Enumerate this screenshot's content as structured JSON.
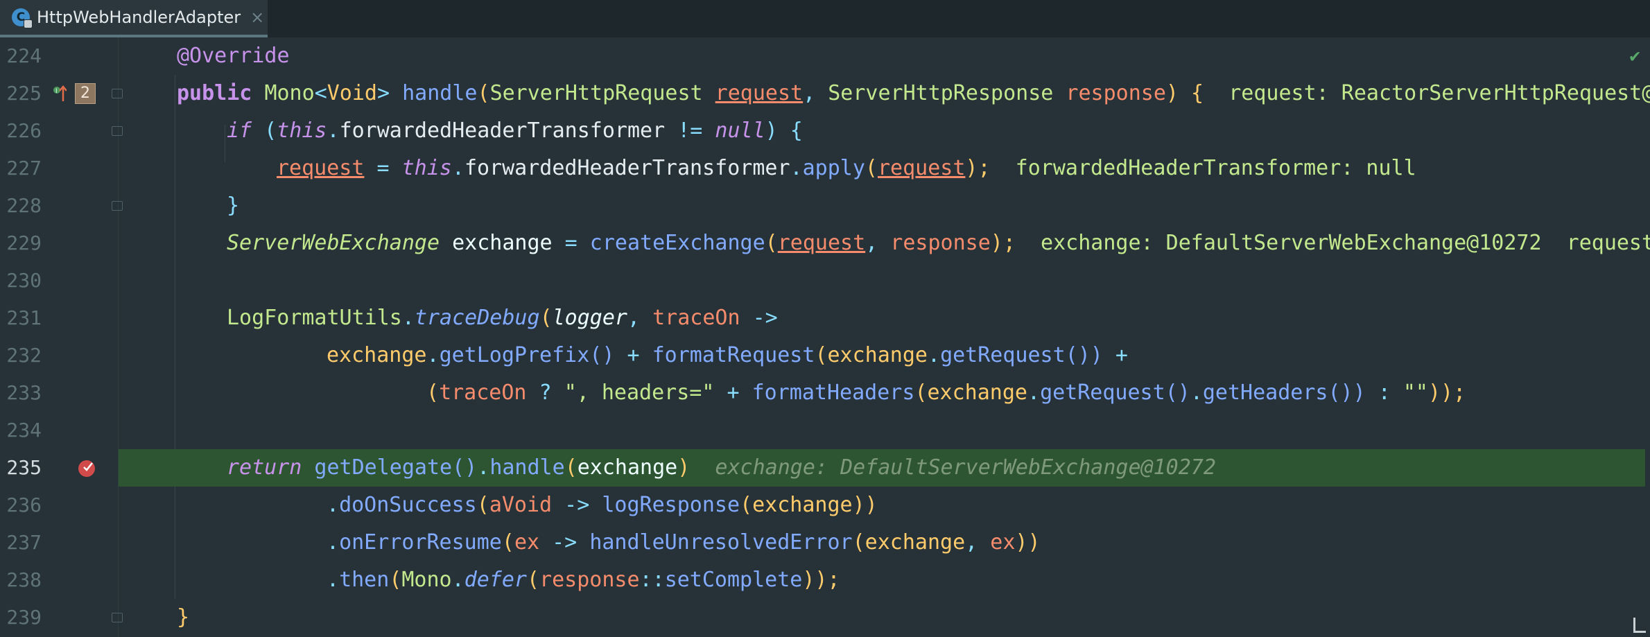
{
  "tab": {
    "title": "HttpWebHandlerAdapter",
    "icon": "class-icon",
    "close_icon": "×"
  },
  "status": {
    "analysis_icon": "✔"
  },
  "lines": [
    {
      "num": "224"
    },
    {
      "num": "225",
      "badge": "2"
    },
    {
      "num": "226"
    },
    {
      "num": "227"
    },
    {
      "num": "228"
    },
    {
      "num": "229"
    },
    {
      "num": "230"
    },
    {
      "num": "231"
    },
    {
      "num": "232"
    },
    {
      "num": "233"
    },
    {
      "num": "234"
    },
    {
      "num": "235"
    },
    {
      "num": "236"
    },
    {
      "num": "237"
    },
    {
      "num": "238"
    },
    {
      "num": "239"
    }
  ],
  "code": {
    "l224": {
      "annotation": "@Override"
    },
    "l225": {
      "public": "public",
      "mono": "Mono",
      "lt": "<",
      "void": "Void",
      "gt": ">",
      "method": "handle",
      "paren_open": "(",
      "type1": "ServerHttpRequest",
      "p1": "request",
      "comma": ", ",
      "type2": "ServerHttpResponse",
      "p2": "response",
      "paren_close": ")",
      "brace": " {",
      "hint": "  request: ReactorServerHttpRequest@"
    },
    "l226": {
      "if": "if",
      "open": " (",
      "this": "this",
      "dot": ".",
      "field": "forwardedHeaderTransformer",
      "neq": " != ",
      "null": "null",
      "close": ")",
      "brace": " {"
    },
    "l227": {
      "var": "request",
      "eq": " = ",
      "this": "this",
      "dot": ".",
      "field": "forwardedHeaderTransformer",
      "dot2": ".",
      "apply": "apply",
      "open": "(",
      "arg": "request",
      "close": ");",
      "hint": "  forwardedHeaderTransformer: null"
    },
    "l228": {
      "brace": "}"
    },
    "l229": {
      "type": "ServerWebExchange",
      "var": " exchange",
      "eq": " = ",
      "fn": "createExchange",
      "open": "(",
      "a1": "request",
      "comma": ", ",
      "a2": "response",
      "close": ");",
      "hint": "  exchange: DefaultServerWebExchange@10272  request"
    },
    "l231": {
      "cls": "LogFormatUtils",
      "dot": ".",
      "fn": "traceDebug",
      "open": "(",
      "logger": "logger",
      "comma": ", ",
      "traceOn": "traceOn",
      "arrow": " ->"
    },
    "l232": {
      "ex": "exchange",
      "dot": ".",
      "fn1": "getLogPrefix",
      "par": "()",
      "plus": " + ",
      "fn2": "formatRequest",
      "open": "(",
      "ex2": "exchange",
      "dot2": ".",
      "fn3": "getRequest",
      "close": "())",
      "plus2": " +"
    },
    "l233": {
      "open": "(",
      "traceOn": "traceOn",
      "q": " ? ",
      "str1": "\", headers=\"",
      "plus": " + ",
      "fn": "formatHeaders",
      "open2": "(",
      "ex": "exchange",
      "dot": ".",
      "fn2": "getRequest",
      "par": "()",
      "dot2": ".",
      "fn3": "getHeaders",
      "par2": "())",
      "colon": " : ",
      "str2": "\"\"",
      "close": "));"
    },
    "l235": {
      "return": "return",
      "fn": " getDelegate",
      "par": "()",
      "dot": ".",
      "fn2": "handle",
      "open": "(",
      "ex": "exchange",
      "close": ")",
      "hint": "  exchange: DefaultServerWebExchange@10272"
    },
    "l236": {
      "dot": ".",
      "fn": "doOnSuccess",
      "open": "(",
      "p": "aVoid",
      "arrow": " -> ",
      "fn2": "logResponse",
      "open2": "(",
      "ex": "exchange",
      "close": "))"
    },
    "l237": {
      "dot": ".",
      "fn": "onErrorResume",
      "open": "(",
      "p": "ex",
      "arrow": " -> ",
      "fn2": "handleUnresolvedError",
      "open2": "(",
      "ex": "exchange",
      "comma": ", ",
      "p2": "ex",
      "close": "))"
    },
    "l238": {
      "dot": ".",
      "fn": "then",
      "open": "(",
      "cls": "Mono",
      "dot2": ".",
      "fn2": "defer",
      "open2": "(",
      "ref": "response",
      "dc": "::",
      "fn3": "setComplete",
      "close": "));"
    },
    "l239": {
      "brace": "}"
    }
  },
  "colors": {
    "background": "#263238",
    "execution_line": "#2e5532",
    "keyword": "#c792ea",
    "type": "#ffcb6b",
    "function": "#82aaff",
    "parameter": "#f78c6c"
  }
}
